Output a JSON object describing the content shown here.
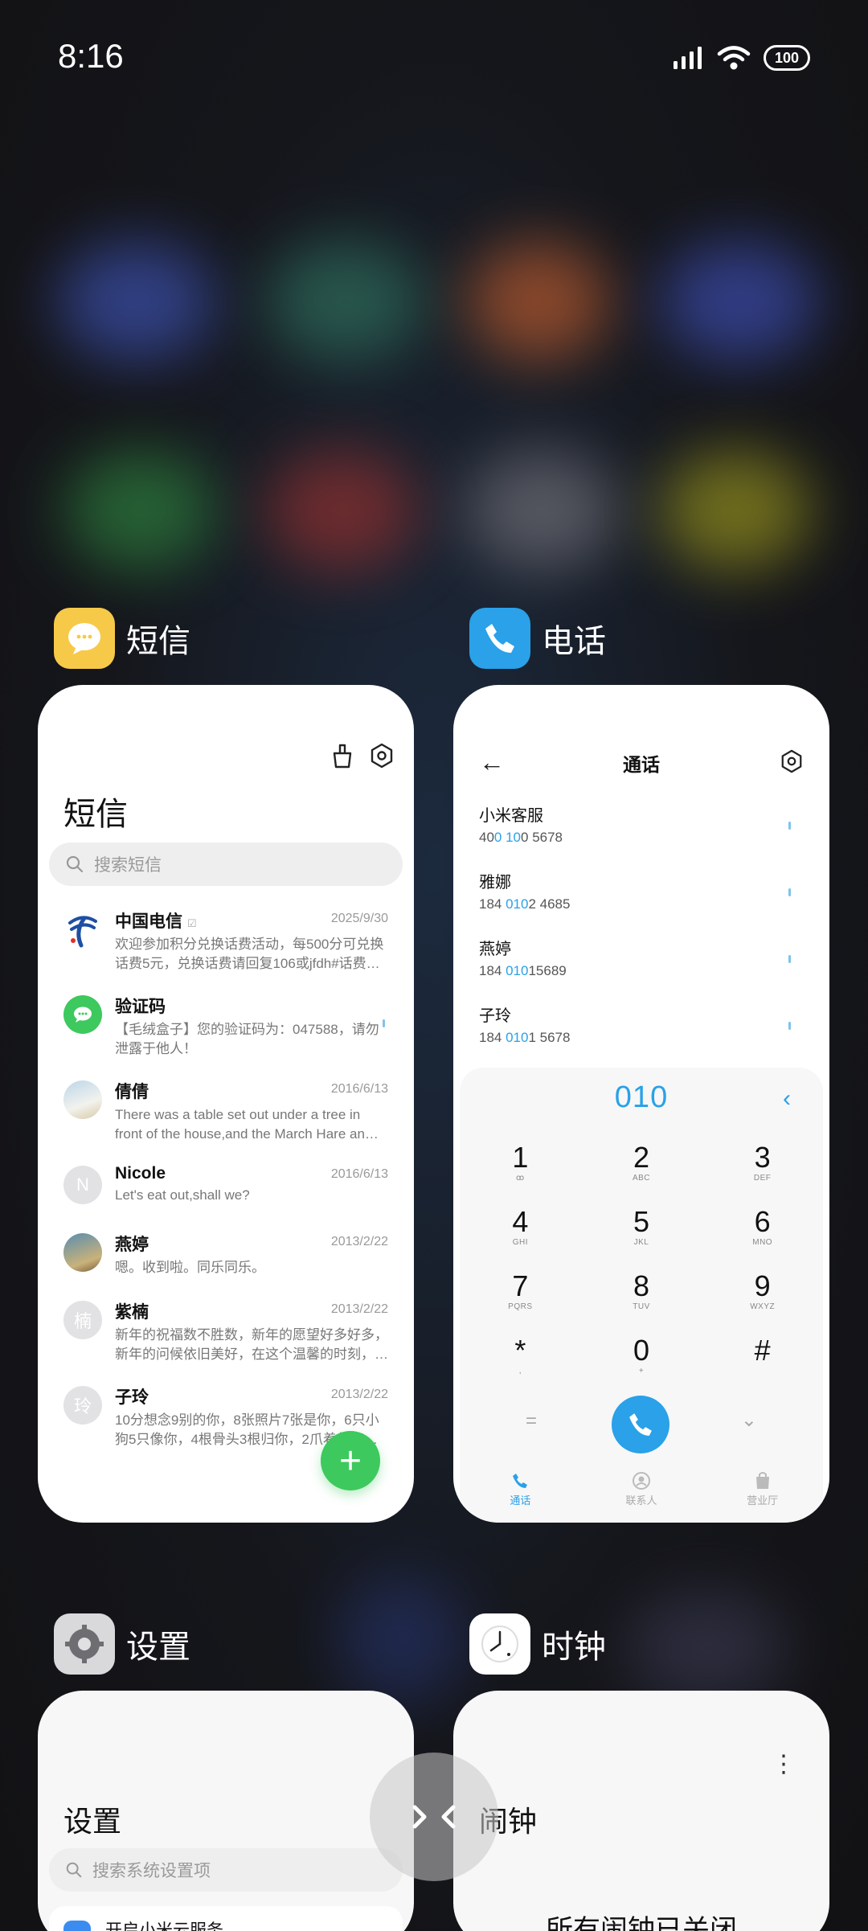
{
  "status_bar": {
    "time": "8:16",
    "battery": "100"
  },
  "apps": {
    "messages": {
      "app_name": "短信",
      "title": "短信",
      "search_placeholder": "搜索短信",
      "items": [
        {
          "name": "中国电信",
          "date": "2025/9/30",
          "text": "欢迎参加积分兑换话费活动，每500分可兑换话费5元，兑换话费请回复106或jfdh#话费…",
          "avatar": "telecom"
        },
        {
          "name": "验证码",
          "date": "",
          "text": "【毛绒盒子】您的验证码为：047588，请勿泄露于他人！",
          "avatar": "chat"
        },
        {
          "name": "倩倩",
          "date": "2016/6/13",
          "text": "There was a table set out under a tree in front of the house,and the March Hare an…",
          "avatar": "photo"
        },
        {
          "name": "Nicole",
          "date": "2016/6/13",
          "text": "Let's eat out,shall we?",
          "avatar": "N"
        },
        {
          "name": "燕婷",
          "date": "2013/2/22",
          "text": "嗯。收到啦。同乐同乐。",
          "avatar": "photo2"
        },
        {
          "name": "紫楠",
          "date": "2013/2/22",
          "text": "新年的祝福数不胜数，新年的愿望好多好多，新年的问候依旧美好，在这个温馨的时刻，…",
          "avatar": "楠"
        },
        {
          "name": "子玲",
          "date": "2013/2/22",
          "text": "10分想念9别的你，8张照片7张是你，6只小狗5只像你，4根骨头3根归你，2爪着你家…",
          "avatar": "玲"
        }
      ],
      "fab_label": "+"
    },
    "phone": {
      "app_name": "电话",
      "title": "通话",
      "contacts": [
        {
          "name": "小米客服",
          "pre": "40",
          "hl": "0 10",
          "post": "0 5678"
        },
        {
          "name": "雅娜",
          "pre": "184 ",
          "hl": "010",
          "post": "2 4685"
        },
        {
          "name": "燕婷",
          "pre": "184 ",
          "hl": "010",
          "post": "15689"
        },
        {
          "name": "子玲",
          "pre": "184 ",
          "hl": "010",
          "post": "1 5678"
        }
      ],
      "dial_input": "010",
      "keys": [
        {
          "main": "1",
          "sub": "ꝏ"
        },
        {
          "main": "2",
          "sub": "ABC"
        },
        {
          "main": "3",
          "sub": "DEF"
        },
        {
          "main": "4",
          "sub": "GHI"
        },
        {
          "main": "5",
          "sub": "JKL"
        },
        {
          "main": "6",
          "sub": "MNO"
        },
        {
          "main": "7",
          "sub": "PQRS"
        },
        {
          "main": "8",
          "sub": "TUV"
        },
        {
          "main": "9",
          "sub": "WXYZ"
        },
        {
          "main": "*",
          "sub": ","
        },
        {
          "main": "0",
          "sub": "+"
        },
        {
          "main": "#",
          "sub": ""
        }
      ],
      "tabs": [
        {
          "label": "通话",
          "active": true
        },
        {
          "label": "联系人"
        },
        {
          "label": "营业厅"
        }
      ]
    },
    "settings": {
      "app_name": "设置",
      "title": "设置",
      "search_placeholder": "搜索系统设置项",
      "first_row": "开启小米云服务"
    },
    "clock": {
      "app_name": "时钟",
      "title": "闹钟",
      "status": "所有闹钟已关闭"
    }
  },
  "colors": {
    "accent_blue": "#2aa1e8",
    "fab_green": "#3dc95d",
    "msg_icon_yellow": "#f7c948"
  }
}
